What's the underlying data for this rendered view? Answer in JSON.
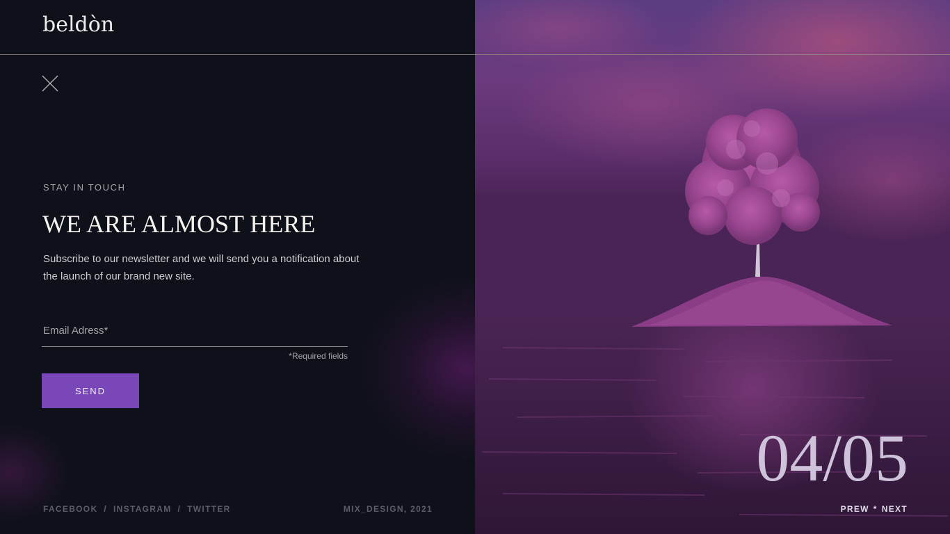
{
  "brand": {
    "logo": "beldòn"
  },
  "intro": {
    "eyebrow": "STAY IN TOUCH",
    "headline": "WE ARE ALMOST HERE",
    "description": "Subscribe to our newsletter and we will send you a notification about the launch of our brand new site."
  },
  "form": {
    "email_placeholder": "Email Adress*",
    "email_value": "",
    "required_note": "*Required fields",
    "send_label": "SEND"
  },
  "footer": {
    "social": [
      "FACEBOOK",
      "INSTAGRAM",
      "TWITTER"
    ],
    "separator": "/",
    "credit": "MIX_DESIGN, 2021"
  },
  "slider": {
    "counter": "04/05",
    "prev_label": "PREW",
    "separator": "*",
    "next_label": "NEXT"
  },
  "colors": {
    "background": "#0f111a",
    "accent": "#7a47b8",
    "divider": "#8f8a7e"
  },
  "icons": {
    "close": "close-icon"
  }
}
